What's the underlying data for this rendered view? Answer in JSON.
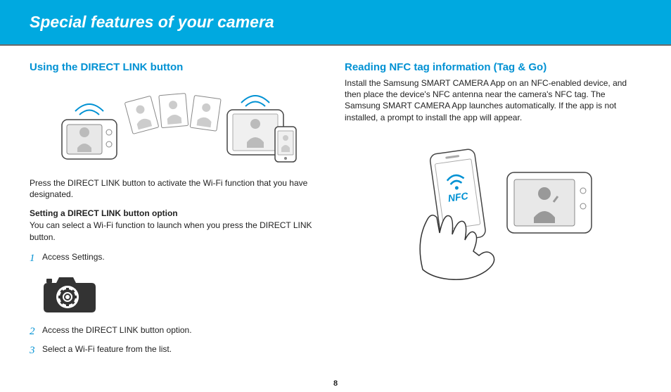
{
  "banner": {
    "title": "Special features of your camera"
  },
  "left": {
    "heading": "Using the DIRECT LINK button",
    "para1": "Press the DIRECT LINK button to activate the Wi-Fi function that you have designated.",
    "subhead": "Setting a DIRECT LINK button option",
    "para2": "You can select a Wi-Fi function to launch when you press the DIRECT LINK button.",
    "steps": [
      {
        "n": "1",
        "text": "Access Settings."
      },
      {
        "n": "2",
        "text": "Access the DIRECT LINK button option."
      },
      {
        "n": "3",
        "text": "Select a Wi-Fi feature from the list."
      }
    ]
  },
  "right": {
    "heading": "Reading NFC tag information (Tag & Go)",
    "para1": "Install the Samsung SMART CAMERA App on an NFC-enabled device, and then place the device's NFC antenna near the camera's NFC tag. The Samsung SMART CAMERA App launches automatically. If the app is not installed, a prompt to install the app will appear.",
    "nfc_label": "NFC"
  },
  "page_number": "8"
}
